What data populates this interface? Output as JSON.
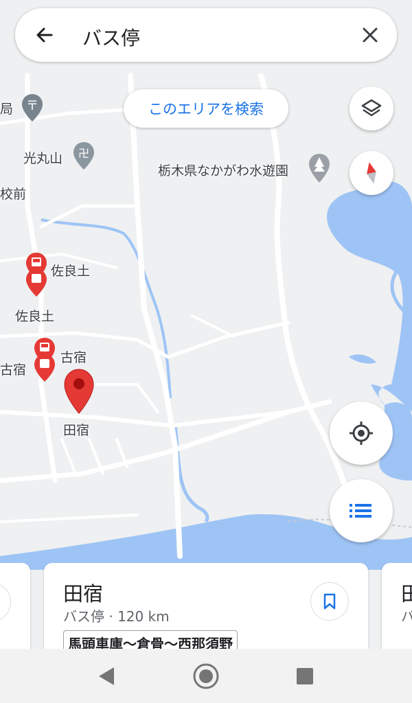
{
  "search": {
    "query": "バス停"
  },
  "map": {
    "search_area_button": "このエリアを検索",
    "labels": {
      "kyoku": "局",
      "kosei": "光丸山",
      "park": "栃木県なかがわ水遊園",
      "kou_mae": "校前",
      "sarado_1": "佐良土",
      "sarado_2": "佐良土",
      "furujuku_1": "古宿",
      "furujuku_2": "古宿",
      "tajuku": "田宿"
    }
  },
  "cards": [
    {
      "title": "田宿",
      "subtitle": "バス停 · 120 km",
      "route": "馬頭車庫〜倉骨〜西那須野"
    },
    {
      "title": "田",
      "subtitle": "バ"
    }
  ],
  "colors": {
    "water": "#9ec4f5",
    "accent": "#1a73e8",
    "pin_red": "#e53935"
  }
}
